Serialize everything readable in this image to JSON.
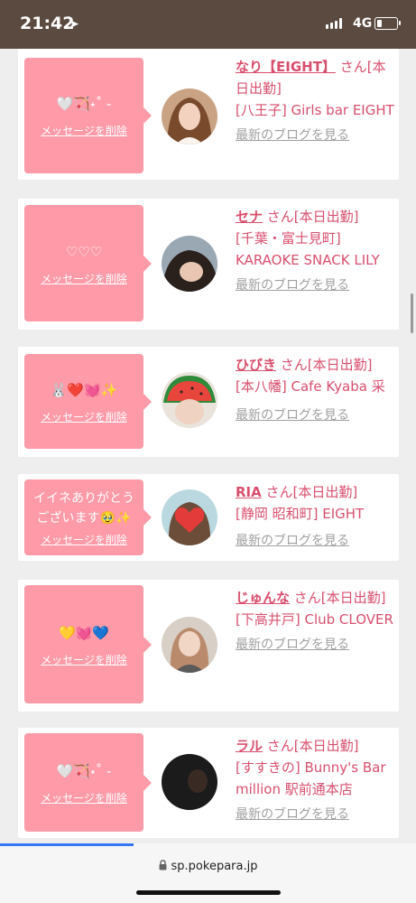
{
  "status": {
    "time": "21:42",
    "network": "4G",
    "battery_level": 0.25
  },
  "cards": [
    {
      "message": "🤍🏹˖˚ ‑",
      "delete_label": "メッセージを削除",
      "name": "なり【EIGHT】",
      "suffix": " さん",
      "status": "[本日出勤]",
      "store": "[八王子] Girls bar EIGHT",
      "blog": "最新のブログを見る"
    },
    {
      "message": "♡♡♡",
      "delete_label": "メッセージを削除",
      "name": "セナ",
      "suffix": " さん",
      "status": "[本日出勤]",
      "store": "[千葉・富士見町] KARAOKE SNACK LILY",
      "blog": "最新のブログを見る"
    },
    {
      "message": "🐰❤️💓✨",
      "delete_label": "メッセージを削除",
      "name": "ひびき",
      "suffix": " さん",
      "status": "[本日出勤]",
      "store": "[本八幡] Cafe Kyaba 采",
      "blog": "最新のブログを見る"
    },
    {
      "message": "イイネありがとうございます🥹✨",
      "delete_label": "メッセージを削除",
      "name": "RIA",
      "suffix": " さん",
      "status": "[本日出勤]",
      "store": "[静岡 昭和町] EIGHT",
      "blog": "最新のブログを見る"
    },
    {
      "message": "💛💓💙",
      "delete_label": "メッセージを削除",
      "name": "じゅんな",
      "suffix": " さん",
      "status": "[本日出勤]",
      "store": "[下高井戸] Club CLOVER",
      "blog": "最新のブログを見る"
    },
    {
      "message": "🤍🏹˖˚ ‑",
      "delete_label": "メッセージを削除",
      "name": "ラル",
      "suffix": " さん",
      "status": "[本日出勤]",
      "store": "[すすきの] Bunny's Bar million 駅前通本店",
      "blog": "最新のブログを見る"
    }
  ],
  "browser": {
    "url": "sp.pokepara.jp",
    "load_progress": 0.32
  },
  "icons": {
    "location": "location-arrow-icon",
    "lock": "lock-icon",
    "signal": "signal-icon",
    "battery": "battery-icon"
  },
  "colors": {
    "status_bar": "#5b4a40",
    "bubble": "#ff9aa8",
    "name": "#d94f6e",
    "blog": "#a0a0a0",
    "progress": "#3478f6"
  }
}
